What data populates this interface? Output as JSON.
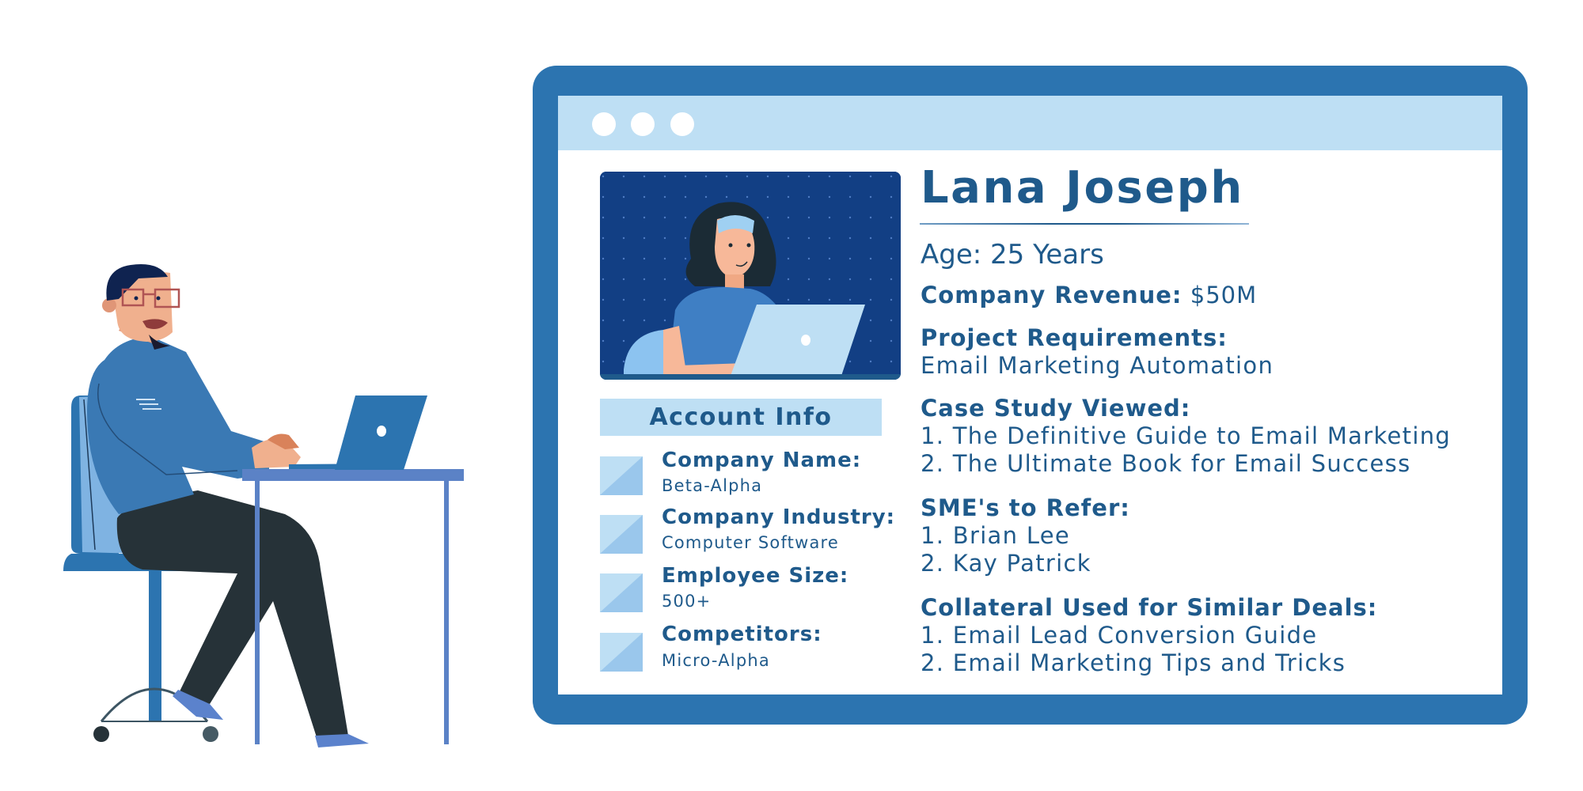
{
  "window": {
    "dots": [
      "window-dot",
      "window-dot",
      "window-dot"
    ]
  },
  "profile": {
    "name": "Lana Joseph",
    "age": "Age: 25 Years",
    "revenue_label": "Company Revenue:",
    "revenue_value": "$50M",
    "requirements_label": "Project Requirements:",
    "requirements_value": "Email Marketing Automation",
    "case_studies_label": "Case Study Viewed:",
    "case_studies": [
      "1.  The Definitive Guide to Email Marketing",
      "2. The Ultimate Book for Email Success"
    ],
    "smes_label": "SME's to Refer:",
    "smes": [
      "1.  Brian Lee",
      "2. Kay Patrick"
    ],
    "collateral_label": "Collateral Used for Similar Deals:",
    "collateral": [
      "1.  Email Lead Conversion Guide",
      "2. Email Marketing Tips and Tricks"
    ]
  },
  "account_info": {
    "title": "Account Info",
    "fields": [
      {
        "label": "Company Name:",
        "value": "Beta-Alpha"
      },
      {
        "label": "Company Industry:",
        "value": "Computer Software"
      },
      {
        "label": "Employee Size:",
        "value": "500+"
      },
      {
        "label": "Competitors:",
        "value": "Micro-Alpha"
      }
    ]
  },
  "colors": {
    "frame": "#2c74b0",
    "titlebar": "#bedff4",
    "text": "#1f5a8b",
    "avatar_bg": "#123f84"
  }
}
